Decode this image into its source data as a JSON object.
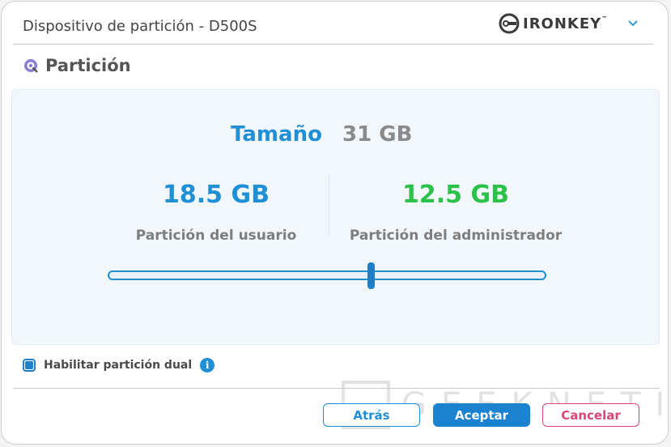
{
  "window": {
    "title": "Dispositivo de partición - D500S",
    "brand": "IRONKEY",
    "brand_tm": "™"
  },
  "section": {
    "title": "Partición"
  },
  "size": {
    "label": "Tamaño",
    "value": "31 GB"
  },
  "user_partition": {
    "value": "18.5 GB",
    "label": "Partición del usuario"
  },
  "admin_partition": {
    "value": "12.5 GB",
    "label": "Partición del administrador"
  },
  "slider": {
    "fraction": 0.6
  },
  "dual_partition": {
    "label": "Habilitar partición dual",
    "checked": true
  },
  "buttons": {
    "back": "Atrás",
    "accept": "Aceptar",
    "cancel": "Cancelar"
  },
  "watermark": {
    "text": "GEEKNETIC"
  },
  "colors": {
    "accent": "#1f8fd6",
    "admin_green": "#2cc24a",
    "cancel_pink": "#d8457a"
  },
  "icons": {
    "partition": "disk-search-icon",
    "logo": "ironkey-logo-icon",
    "expand": "chevron-down-icon",
    "info": "info-icon"
  }
}
